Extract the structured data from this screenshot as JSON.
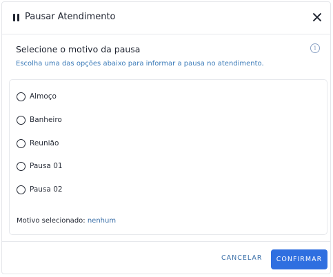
{
  "header": {
    "title": "Pausar Atendimento",
    "icon": "pause-icon",
    "close_icon": "close-icon"
  },
  "section": {
    "title": "Selecione o motivo da pausa",
    "subtitle": "Escolha uma das opções abaixo para informar a pausa no atendimento.",
    "info_icon": "info-icon"
  },
  "options": [
    {
      "label": "Almoço",
      "selected": false
    },
    {
      "label": "Banheiro",
      "selected": false
    },
    {
      "label": "Reunião",
      "selected": false
    },
    {
      "label": "Pausa 01",
      "selected": false
    },
    {
      "label": "Pausa 02",
      "selected": false
    }
  ],
  "selection": {
    "prefix": "Motivo selecionado:",
    "value": "nenhum"
  },
  "footer": {
    "cancel_label": "CANCELAR",
    "confirm_label": "CONFIRMAR"
  },
  "colors": {
    "accent": "#2f6fe0",
    "link": "#3a6fa8",
    "text": "#1f2430",
    "subtitle": "#3a7ab8"
  }
}
